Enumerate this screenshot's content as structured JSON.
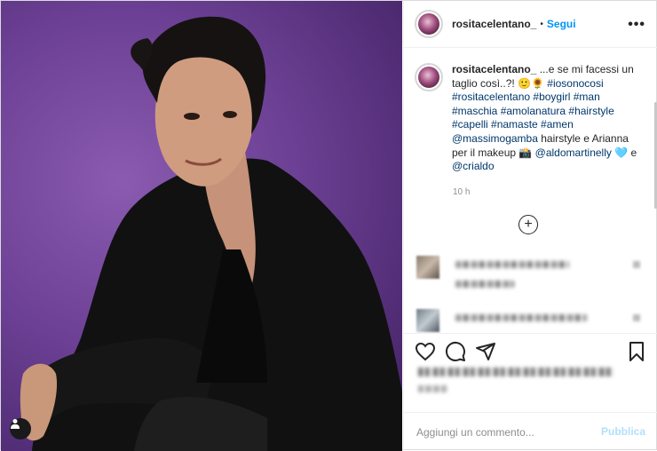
{
  "post": {
    "username": "rositacelentano_",
    "dot": "•",
    "follow_label": "Segui",
    "more_icon": "more-dots-icon"
  },
  "caption": {
    "username": "rositacelentano_",
    "text_start": " ...e se mi facessi un taglio così..?! 🙂🌻 ",
    "tags1": "#iosonocosi #rositacelentano #boygirl #man #maschia #amolanatura #hairstyle #capelli #namaste #amen",
    "mention1": "@massimogamba",
    "text_mid": " hairstyle e Arianna per il makeup 📸 ",
    "mention2": "@aldomartinelly",
    "heart": " 🩵 e ",
    "mention3": "@crialdo",
    "time": "10 h"
  },
  "load_more_icon": "plus-circle-icon",
  "comment_input": {
    "placeholder": "Aggiungi un commento...",
    "publish_label": "Pubblica"
  },
  "colors": {
    "accent": "#0095f6",
    "tag": "#00376b",
    "publish_disabled": "#b2dffc",
    "background_purple": "#6b3f93"
  }
}
